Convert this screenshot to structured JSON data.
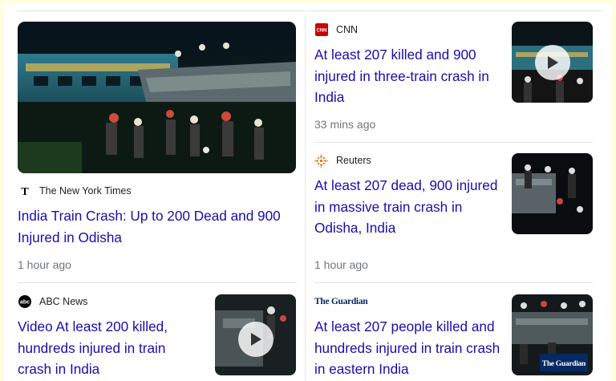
{
  "articles": [
    {
      "source": "The New York Times",
      "title": "India Train Crash: Up to 200 Dead and 900 Injured in Odisha",
      "time": "1 hour ago"
    },
    {
      "source": "CNN",
      "logo_text": "CNN",
      "title": "At least 207 killed and 900 injured in three-train crash in India",
      "time": "33 mins ago",
      "has_video": true
    },
    {
      "source": "Reuters",
      "title": "At least 207 dead, 900 injured in massive train crash in Odisha, India",
      "time": "1 hour ago"
    },
    {
      "source": "ABC News",
      "logo_text": "abc",
      "title": "Video At least 200 killed, hundreds injured in train crash in India",
      "has_video": true
    },
    {
      "source": "The Guardian",
      "logo_text": "The Guardian",
      "title": "At least 207 people killed and hundreds injured in train crash in eastern India",
      "thumb_watermark": "The Guardian"
    }
  ],
  "colors": {
    "link": "#1a0dab",
    "meta": "#70757a",
    "cnn_red": "#cc0000",
    "reuters_orange": "#fa6400",
    "guardian_blue": "#052962"
  }
}
